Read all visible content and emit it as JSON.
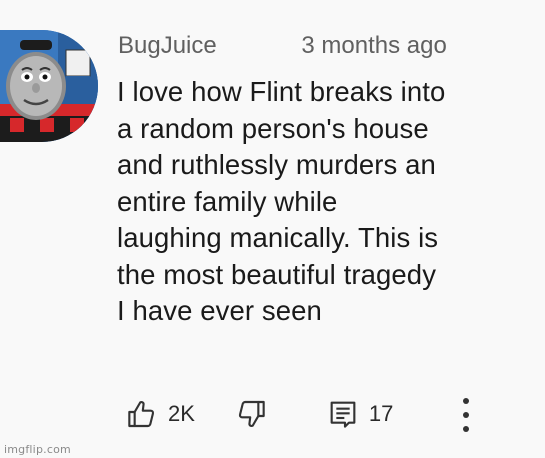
{
  "comment": {
    "author": "BugJuice",
    "time": "3 months ago",
    "text": "I love how Flint breaks into\na random person's house\nand ruthlessly murders an\nentire family while\nlaughing manically. This is\nthe most beautiful tragedy\nI have ever seen",
    "avatar_icon": "tank-engine-face-avatar",
    "actions": {
      "like_icon": "thumb-up-icon",
      "like_count": "2K",
      "dislike_icon": "thumb-down-icon",
      "reply_icon": "reply-comment-icon",
      "reply_count": "17",
      "more_icon": "more-vert-icon"
    }
  },
  "watermark": "imgflip.com",
  "colors": {
    "background": "#f9f9f9",
    "text": "#0f0f0f",
    "secondary_text": "#606060",
    "avatar_blue": "#2f6fb6",
    "avatar_red": "#d6282b"
  }
}
